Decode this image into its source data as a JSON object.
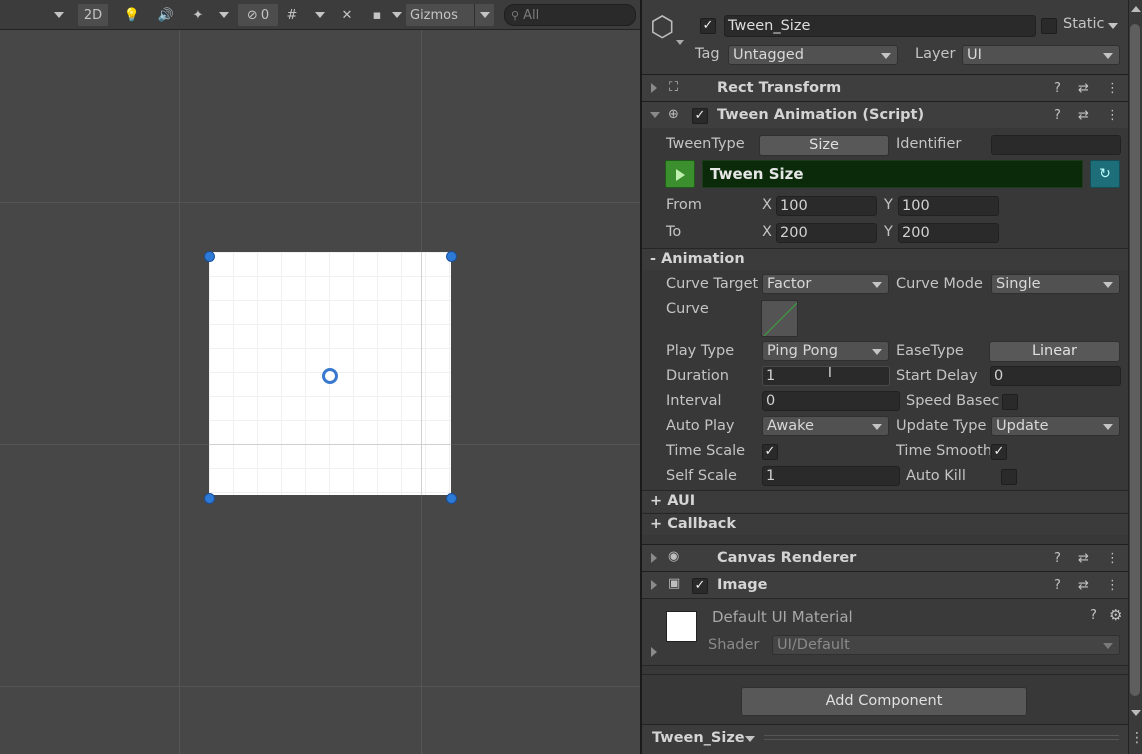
{
  "toolbar": {
    "mode_2d": "2D",
    "hidden_count": "0",
    "gizmos_label": "Gizmos",
    "search_placeholder": "All"
  },
  "object": {
    "name": "Tween_Size",
    "static_label": "Static",
    "tag_label": "Tag",
    "tag_value": "Untagged",
    "layer_label": "Layer",
    "layer_value": "UI"
  },
  "components": {
    "rect_transform": "Rect Transform",
    "tween_animation": "Tween Animation (Script)",
    "canvas_renderer": "Canvas Renderer",
    "image": "Image"
  },
  "tween": {
    "tween_type_label": "TweenType",
    "tween_type_value": "Size",
    "identifier_label": "Identifier",
    "identifier_value": "",
    "bar_title": "Tween Size",
    "from_label": "From",
    "to_label": "To",
    "x_label": "X",
    "y_label": "Y",
    "from_x": "100",
    "from_y": "100",
    "to_x": "200",
    "to_y": "200"
  },
  "animation": {
    "header": "- Animation",
    "curve_target_label": "Curve Target",
    "curve_target_value": "Factor",
    "curve_mode_label": "Curve Mode",
    "curve_mode_value": "Single",
    "curve_label": "Curve",
    "play_type_label": "Play Type",
    "play_type_value": "Ping Pong",
    "ease_type_label": "EaseType",
    "ease_type_value": "Linear",
    "duration_label": "Duration",
    "duration_value": "1",
    "start_delay_label": "Start Delay",
    "start_delay_value": "0",
    "interval_label": "Interval",
    "interval_value": "0",
    "speed_based_label": "Speed Basec",
    "auto_play_label": "Auto Play",
    "auto_play_value": "Awake",
    "update_type_label": "Update Type",
    "update_type_value": "Update",
    "time_scale_label": "Time Scale",
    "time_smooth_label": "Time Smooth",
    "self_scale_label": "Self Scale",
    "self_scale_value": "1",
    "auto_kill_label": "Auto Kill"
  },
  "sections": {
    "aui": "+ AUI",
    "callback": "+ Callback"
  },
  "material": {
    "name": "Default UI Material",
    "shader_label": "Shader",
    "shader_value": "UI/Default"
  },
  "add_component": "Add Component",
  "footer": {
    "name": "Tween_Size"
  },
  "colors": {
    "accent_green": "#0a2a0a",
    "play_green": "#3c8f2e",
    "handle_blue": "#2d7ad6",
    "refresh_teal": "#1e6e7a"
  }
}
